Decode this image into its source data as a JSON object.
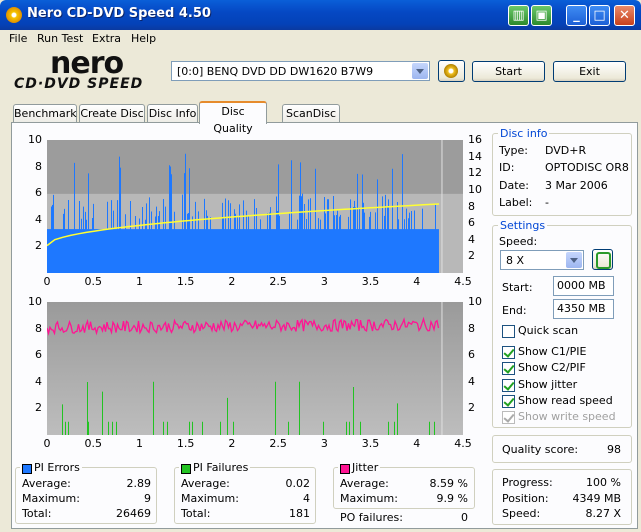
{
  "window": {
    "title": "Nero CD-DVD Speed 4.50"
  },
  "menu": [
    "File",
    "Run Test",
    "Extra",
    "Help"
  ],
  "logo": {
    "top": "nero",
    "bottom": "CD·DVD SPEED"
  },
  "drive": {
    "selected": "[0:0]  BENQ DVD DD DW1620 B7W9"
  },
  "buttons": {
    "start": "Start",
    "exit": "Exit"
  },
  "tabs": [
    "Benchmark",
    "Create Disc",
    "Disc Info",
    "Disc Quality",
    "ScanDisc"
  ],
  "active_tab": "Disc Quality",
  "disc_info": {
    "title": "Disc info",
    "rows": [
      {
        "label": "Type:",
        "value": "DVD+R"
      },
      {
        "label": "ID:",
        "value": "OPTODISC OR8"
      },
      {
        "label": "Date:",
        "value": "3 Mar 2006"
      },
      {
        "label": "Label:",
        "value": "-"
      }
    ]
  },
  "settings": {
    "title": "Settings",
    "speed_label": "Speed:",
    "speed_value": "8 X",
    "start_label": "Start:",
    "start_value": "0000 MB",
    "end_label": "End:",
    "end_value": "4350 MB",
    "checks": [
      {
        "label": "Quick scan",
        "checked": false,
        "disabled": false
      },
      {
        "label": "Show C1/PIE",
        "checked": true,
        "disabled": false
      },
      {
        "label": "Show C2/PIF",
        "checked": true,
        "disabled": false
      },
      {
        "label": "Show jitter",
        "checked": true,
        "disabled": false
      },
      {
        "label": "Show read speed",
        "checked": true,
        "disabled": false
      },
      {
        "label": "Show write speed",
        "checked": true,
        "disabled": true
      }
    ]
  },
  "quality": {
    "label": "Quality score:",
    "value": "98"
  },
  "progress": {
    "rows": [
      {
        "label": "Progress:",
        "value": "100 %"
      },
      {
        "label": "Position:",
        "value": "4349 MB"
      },
      {
        "label": "Speed:",
        "value": "8.27 X"
      }
    ]
  },
  "stats": {
    "pi_errors": {
      "title": "PI Errors",
      "color": "#1e78ff",
      "average": "2.89",
      "maximum": "9",
      "total": "26469"
    },
    "pi_failures": {
      "title": "PI Failures",
      "color": "#22c322",
      "average": "0.02",
      "maximum": "4",
      "total": "181"
    },
    "jitter": {
      "title": "Jitter",
      "color": "#ff1493",
      "average": "8.59 %",
      "maximum": "9.9 %",
      "po_label": "PO failures:",
      "po_value": "0"
    },
    "labels": {
      "average": "Average:",
      "maximum": "Maximum:",
      "total": "Total:"
    }
  },
  "chart_data": [
    {
      "type": "bar",
      "name": "PI Errors / Read speed",
      "x_ticks": [
        "0",
        "0.5",
        "1",
        "1.5",
        "2",
        "2.5",
        "3",
        "3.5",
        "4",
        "4.5"
      ],
      "y_left_ticks": [
        "2",
        "4",
        "6",
        "8",
        "10"
      ],
      "y_right_ticks": [
        "2",
        "4",
        "6",
        "8",
        "10",
        "12",
        "14",
        "16"
      ],
      "xlim": [
        0,
        4.5
      ],
      "ylim_left": [
        0,
        10
      ],
      "ylim_right": [
        0,
        16
      ],
      "series": [
        {
          "name": "PI Errors",
          "color": "#1e78ff",
          "typical": [
            1,
            3
          ],
          "frequent_peaks": [
            4,
            6
          ],
          "max": 9
        },
        {
          "name": "Read speed",
          "color": "#ffff33",
          "start": 3.3,
          "end": 8.3
        }
      ]
    },
    {
      "type": "bar",
      "name": "PI Failures / Jitter",
      "x_ticks": [
        "0",
        "0.5",
        "1",
        "1.5",
        "2",
        "2.5",
        "3",
        "3.5",
        "4",
        "4.5"
      ],
      "y_left_ticks": [
        "2",
        "4",
        "6",
        "8",
        "10"
      ],
      "y_right_ticks": [
        "2",
        "4",
        "6",
        "8",
        "10"
      ],
      "xlim": [
        0,
        4.5
      ],
      "ylim_left": [
        0,
        10
      ],
      "ylim_right": [
        0,
        10
      ],
      "series": [
        {
          "name": "PI Failures",
          "color": "#22c322",
          "max": 4
        },
        {
          "name": "Jitter",
          "color": "#ff1493",
          "average": 8.59,
          "max": 9.9
        }
      ]
    }
  ]
}
